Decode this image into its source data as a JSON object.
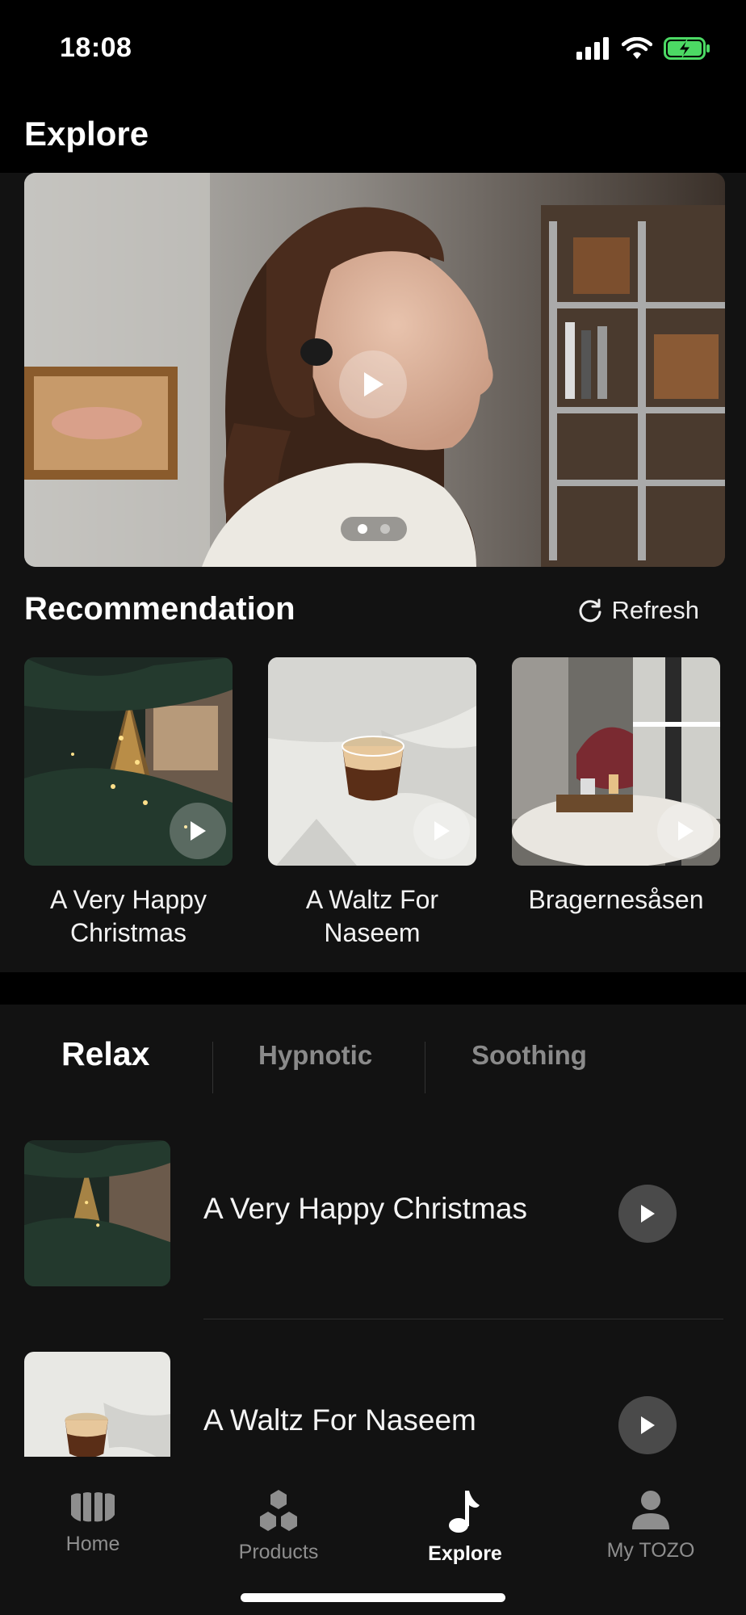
{
  "status_bar": {
    "time": "18:08"
  },
  "header": {
    "title": "Explore"
  },
  "hero": {
    "slides": 2,
    "active_slide": 0
  },
  "recommendation": {
    "title": "Recommendation",
    "refresh_label": "Refresh",
    "items": [
      {
        "title": "A Very Happy Christmas"
      },
      {
        "title": "A Waltz For Naseem"
      },
      {
        "title": "Bragernesåsen"
      }
    ]
  },
  "tabs": [
    {
      "label": "Relax",
      "active": true
    },
    {
      "label": "Hypnotic",
      "active": false
    },
    {
      "label": "Soothing",
      "active": false
    }
  ],
  "list": [
    {
      "title": "A Very Happy Christmas"
    },
    {
      "title": "A Waltz For Naseem"
    }
  ],
  "bottom_nav": [
    {
      "label": "Home",
      "icon": "earbuds-icon"
    },
    {
      "label": "Products",
      "icon": "hexagons-icon"
    },
    {
      "label": "Explore",
      "icon": "music-note-icon",
      "active": true
    },
    {
      "label": "My TOZO",
      "icon": "person-icon"
    }
  ],
  "colors": {
    "background": "#121212",
    "top_bar": "#000000",
    "accent": "#ffffff",
    "battery": "#4cd964"
  }
}
